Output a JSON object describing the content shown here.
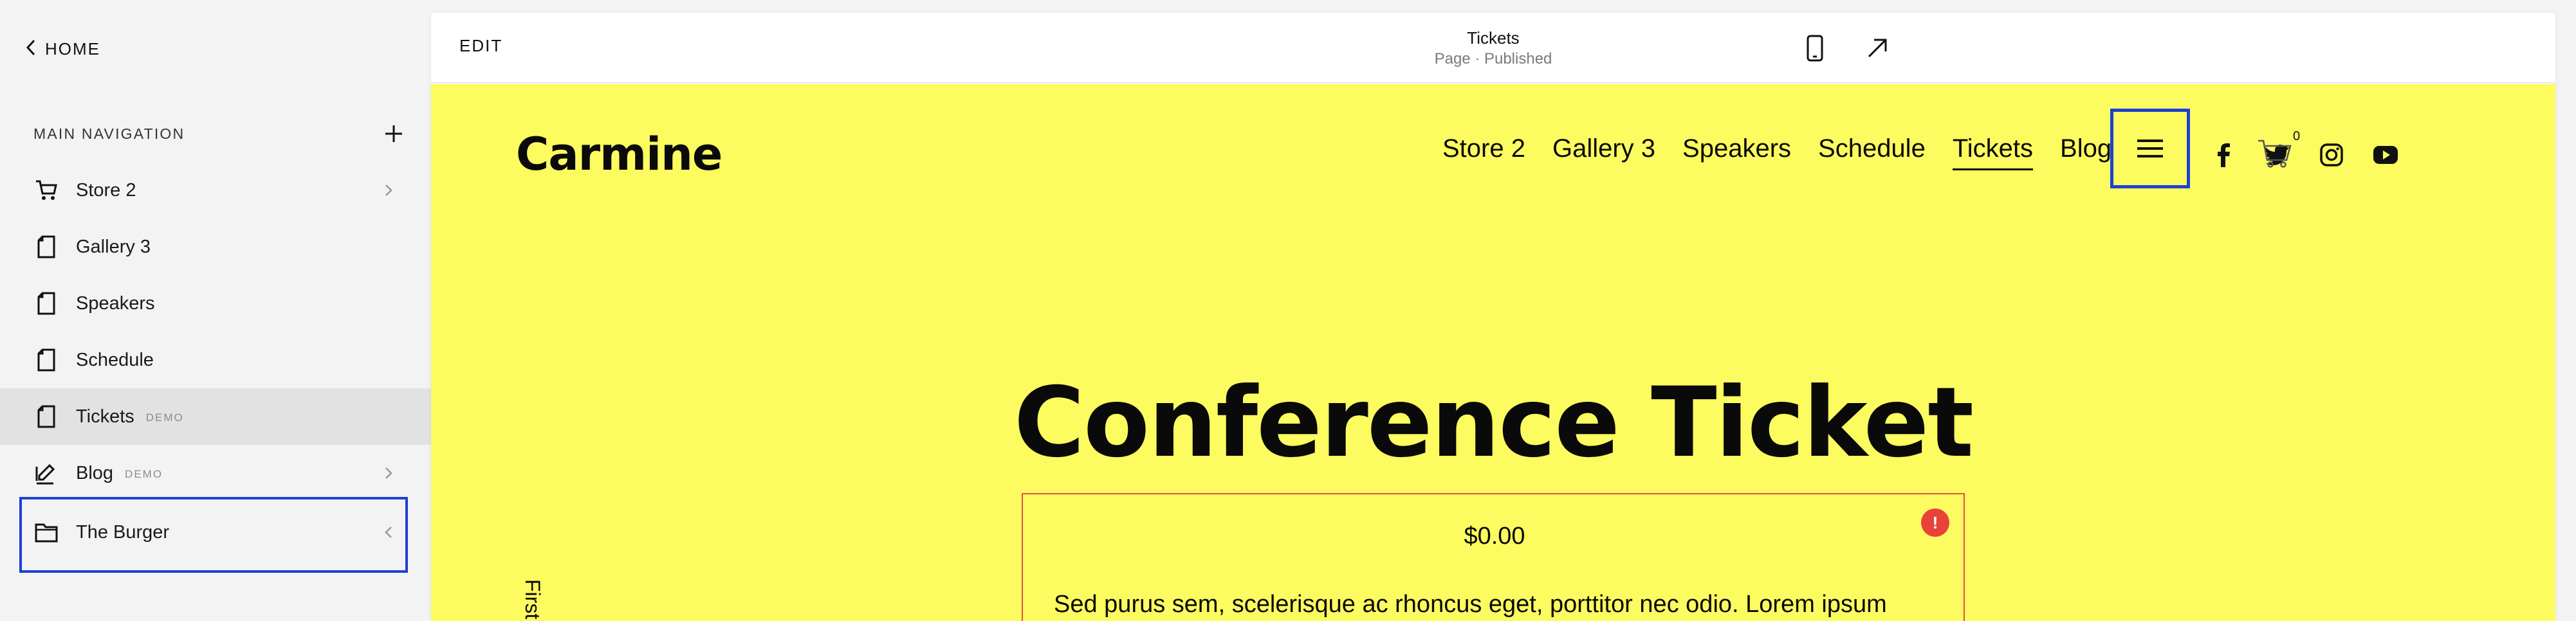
{
  "sidebar": {
    "home_label": "HOME",
    "section_title": "MAIN NAVIGATION",
    "items": [
      {
        "label": "Store 2",
        "badge": "",
        "icon": "cart-icon",
        "chevron": "right"
      },
      {
        "label": "Gallery 3",
        "badge": "",
        "icon": "page-icon",
        "chevron": ""
      },
      {
        "label": "Speakers",
        "badge": "",
        "icon": "page-icon",
        "chevron": ""
      },
      {
        "label": "Schedule",
        "badge": "",
        "icon": "page-icon",
        "chevron": ""
      },
      {
        "label": "Tickets",
        "badge": "DEMO",
        "icon": "page-icon",
        "chevron": "",
        "active": true
      },
      {
        "label": "Blog",
        "badge": "DEMO",
        "icon": "blog-icon",
        "chevron": "right"
      },
      {
        "label": "The Burger",
        "badge": "",
        "icon": "folder-icon",
        "chevron": "left"
      }
    ]
  },
  "topbar": {
    "edit_label": "EDIT",
    "page_title": "Tickets",
    "page_status": "Page · Published"
  },
  "site": {
    "logo": "Carmine",
    "nav": [
      "Store 2",
      "Gallery 3",
      "Speakers",
      "Schedule",
      "Tickets",
      "Blog"
    ],
    "current_nav": "Tickets",
    "cart_count": "0",
    "hero_title": "Conference Ticket",
    "ticket_price": "$0.00",
    "ticket_desc": "Sed purus sem, scelerisque ac rhoncus eget, porttitor nec odio. Lorem ipsum",
    "error_mark": "!",
    "vertical_label": "First"
  },
  "colors": {
    "site_bg": "#fcfb5f",
    "highlight": "#1d3fd6",
    "error": "#e8423b"
  }
}
